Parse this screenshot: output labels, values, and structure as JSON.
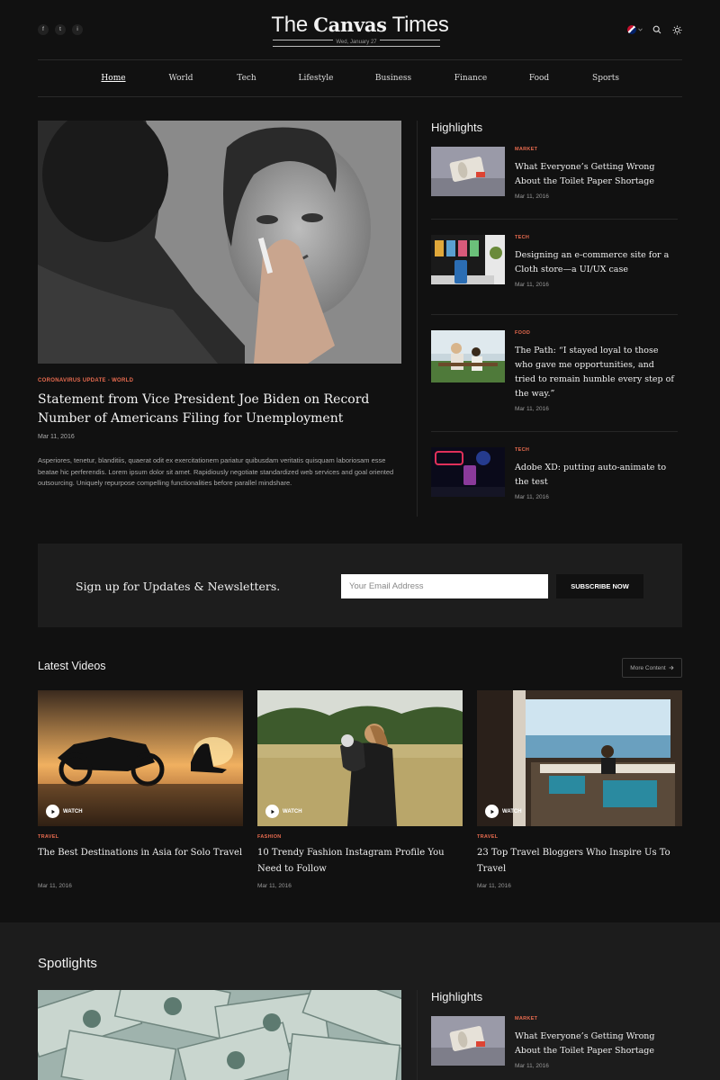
{
  "header": {
    "logo_prefix": "The",
    "logo_bold": "Canvas",
    "logo_suffix": "Times",
    "date": "Wed, January 27",
    "social": [
      "f",
      "t",
      "i"
    ]
  },
  "nav": {
    "items": [
      "Home",
      "World",
      "Tech",
      "Lifestyle",
      "Business",
      "Finance",
      "Food",
      "Sports"
    ],
    "active": "Home"
  },
  "hero": {
    "category": "CORONAVIRUS UPDATE - WORLD",
    "title": "Statement from Vice President Joe Biden on Record Number of Americans Filing for Unemployment",
    "date": "Mar 11, 2016",
    "excerpt": "Asperiores, tenetur, blanditiis, quaerat odit ex exercitationem pariatur quibusdam veritatis quisquam laboriosam esse beatae hic perferendis. Lorem ipsum dolor sit amet. Rapidiously negotiate standardized web services and goal oriented outsourcing. Uniquely repurpose compelling functionalities before parallel mindshare."
  },
  "highlights": {
    "title": "Highlights",
    "items": [
      {
        "category": "MARKET",
        "title": "What Everyone’s Getting Wrong About the Toilet Paper Shortage",
        "date": "Mar 11, 2016"
      },
      {
        "category": "TECH",
        "title": "Designing an e-commerce site for a Cloth store—a UI/UX case",
        "date": "Mar 11, 2016"
      },
      {
        "category": "FOOD",
        "title": "The Path: “I stayed loyal to those who gave me opportunities, and tried to remain humble every step of the way.”",
        "date": "Mar 11, 2016"
      },
      {
        "category": "TECH",
        "title": "Adobe XD: putting auto-animate to the test",
        "date": "Mar 11, 2016"
      }
    ]
  },
  "newsletter": {
    "title": "Sign up for Updates & Newsletters.",
    "placeholder": "Your Email Address",
    "button": "SUBSCRIBE NOW"
  },
  "latest_videos": {
    "title": "Latest Videos",
    "more_label": "More Content",
    "watch_label": "WATCH",
    "items": [
      {
        "category": "TRAVEL",
        "title": "The Best Destinations in Asia for Solo Travel",
        "date": "Mar 11, 2016"
      },
      {
        "category": "FASHION",
        "title": "10 Trendy Fashion Instagram Profile You Need to Follow",
        "date": "Mar 11, 2016"
      },
      {
        "category": "TRAVEL",
        "title": "23 Top Travel Bloggers Who Inspire Us To Travel",
        "date": "Mar 11, 2016"
      }
    ]
  },
  "spotlights": {
    "title": "Spotlights",
    "highlights_title": "Highlights",
    "item": {
      "category": "MARKET",
      "title": "What Everyone’s Getting Wrong About the Toilet Paper Shortage",
      "date": "Mar 11, 2016"
    }
  }
}
